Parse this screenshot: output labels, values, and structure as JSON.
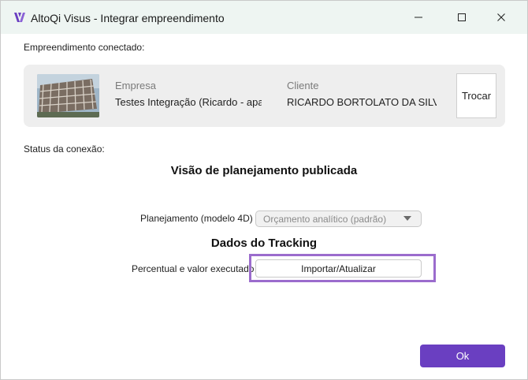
{
  "window": {
    "title": "AltoQi Visus - Integrar empreendimento",
    "logo_icon": "visus-v-logo-icon",
    "controls": [
      "minimize-icon",
      "maximize-icon",
      "close-icon"
    ]
  },
  "connected": {
    "section_label": "Empreendimento conectado:",
    "company_label": "Empresa",
    "company_value": "Testes Integração (Ricardo - apag",
    "client_label": "Cliente",
    "client_value": "RICARDO BORTOLATO DA SILVA",
    "change_button": "Trocar"
  },
  "status": {
    "section_label": "Status da conexão:",
    "heading": "Visão de planejamento publicada",
    "planning_label": "Planejamento (modelo 4D)",
    "planning_selected": "Orçamento analítico (padrão)"
  },
  "tracking": {
    "heading": "Dados do Tracking",
    "executed_label": "Percentual e valor executado",
    "import_button": "Importar/Atualizar"
  },
  "footer": {
    "ok_button": "Ok"
  },
  "colors": {
    "accent": "#6a3fc1",
    "highlight": "#9b6ccd",
    "titlebar": "#eef5f2",
    "card": "#eeeeee"
  }
}
